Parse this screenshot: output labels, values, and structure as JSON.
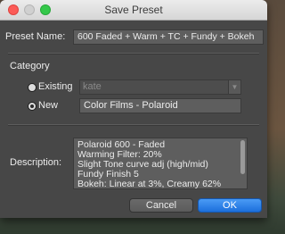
{
  "window": {
    "title": "Save Preset"
  },
  "preset_name": {
    "label": "Preset Name:",
    "value": "600 Faded + Warm + TC + Fundy + Bokeh"
  },
  "category": {
    "heading": "Category",
    "existing": {
      "label": "Existing",
      "selected": false,
      "value": "kate"
    },
    "new": {
      "label": "New",
      "selected": true,
      "value": "Color Films - Polaroid"
    }
  },
  "description": {
    "label": "Description:",
    "lines": [
      "Polaroid 600 - Faded",
      "Warming Filter: 20%",
      "Slight Tone curve adj (high/mid)",
      "Fundy Finish 5",
      "Bokeh: Linear at 3%, Creamy 62%"
    ]
  },
  "buttons": {
    "cancel": "Cancel",
    "ok": "OK"
  },
  "icons": {
    "close": "close-icon",
    "minimize": "minimize-icon",
    "zoom": "zoom-icon",
    "dropdown": "chevron-down-icon"
  },
  "colors": {
    "accent": "#1c6fdc",
    "close": "#fc5b57",
    "zoom": "#34c84a"
  }
}
